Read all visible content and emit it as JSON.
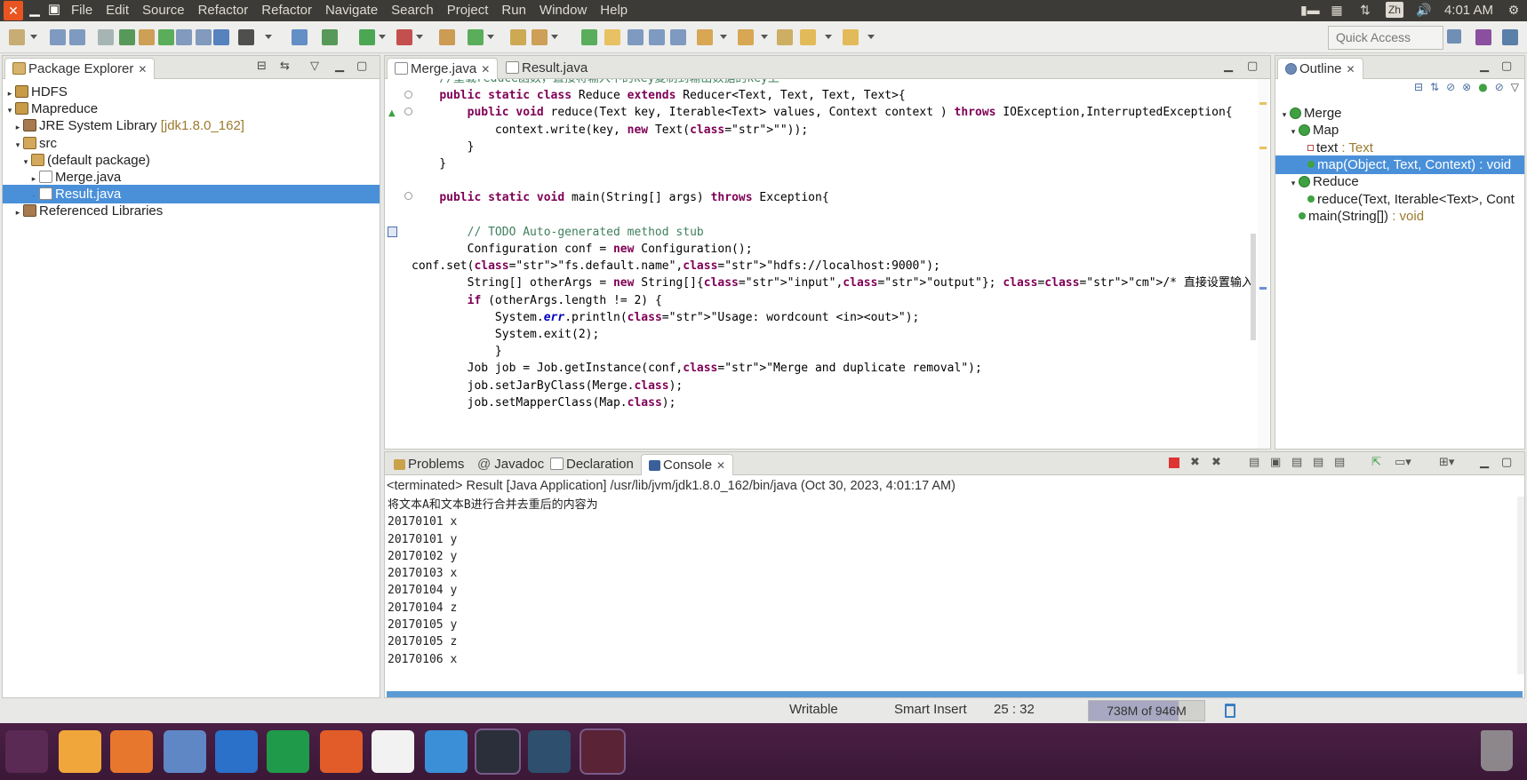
{
  "menubar": {
    "items": [
      "File",
      "Edit",
      "Source",
      "Refactor",
      "Refactor",
      "Navigate",
      "Search",
      "Project",
      "Run",
      "Window",
      "Help"
    ],
    "lang": "Zh",
    "clock": "4:01 AM"
  },
  "toolbar": {
    "quick_access": "Quick Access"
  },
  "package_explorer": {
    "title": "Package Explorer",
    "rows": [
      {
        "label": "HDFS",
        "extra": ""
      },
      {
        "label": "Mapreduce",
        "extra": ""
      },
      {
        "label": "JRE System Library",
        "extra": "[jdk1.8.0_162]"
      },
      {
        "label": "src",
        "extra": ""
      },
      {
        "label": "(default package)",
        "extra": ""
      },
      {
        "label": "Merge.java",
        "extra": ""
      },
      {
        "label": "Result.java",
        "extra": ""
      },
      {
        "label": "Referenced Libraries",
        "extra": ""
      }
    ]
  },
  "editor": {
    "tabs": [
      "Merge.java",
      "Result.java"
    ],
    "lines": [
      "    //重载reduce函数，直接将输入中的key复制到输出数据的key上",
      "    public static class Reduce extends Reducer<Text, Text, Text, Text>{",
      "        public void reduce(Text key, Iterable<Text> values, Context context ) throws IOException,InterruptedException{",
      "            context.write(key, new Text(\"\"));",
      "        }",
      "    }",
      "",
      "    public static void main(String[] args) throws Exception{",
      "",
      "        // TODO Auto-generated method stub",
      "        Configuration conf = new Configuration();",
      "conf.set(\"fs.default.name\",\"hdfs://localhost:9000\");",
      "        String[] otherArgs = new String[]{\"input\",\"output\"}; /* 直接设置输入参数 */",
      "        if (otherArgs.length != 2) {",
      "            System.err.println(\"Usage: wordcount <in><out>\");",
      "            System.exit(2);",
      "            }",
      "        Job job = Job.getInstance(conf,\"Merge and duplicate removal\");",
      "        job.setJarByClass(Merge.class);",
      "        job.setMapperClass(Map.class);"
    ]
  },
  "outline": {
    "title": "Outline",
    "rows": [
      {
        "label": "Merge",
        "type": ""
      },
      {
        "label": "Map",
        "type": ""
      },
      {
        "label": "text",
        "type": " : Text"
      },
      {
        "label": "map(Object, Text, Context)",
        "type": " : void"
      },
      {
        "label": "Reduce",
        "type": ""
      },
      {
        "label": "reduce(Text, Iterable<Text>, Cont",
        "type": ""
      },
      {
        "label": "main(String[])",
        "type": " : void"
      }
    ]
  },
  "bottom": {
    "tabs": [
      "Problems",
      "Javadoc",
      "Declaration",
      "Console"
    ],
    "console_header": "<terminated> Result [Java Application] /usr/lib/jvm/jdk1.8.0_162/bin/java (Oct 30, 2023, 4:01:17 AM)",
    "console_lines": [
      "将文本A和文本B进行合并去重后的内容为",
      "20170101 x",
      "20170101 y",
      "20170102 y",
      "20170103 x",
      "20170104 y",
      "20170104 z",
      "20170105 y",
      "20170105 z",
      "20170106 x"
    ]
  },
  "status": {
    "writable": "Writable",
    "insert": "Smart Insert",
    "position": "25 : 32",
    "memory": "738M of 946M",
    "memory_used_fraction": 0.78
  },
  "dock": {
    "apps": [
      "ubuntu-icon",
      "files-icon",
      "firefox-icon",
      "chromium-icon",
      "word-icon",
      "excel-icon",
      "powerpoint-icon",
      "input-method-icon",
      "screenshot-icon",
      "vscode-icon",
      "eclipse-icon",
      "terminal-icon"
    ]
  }
}
